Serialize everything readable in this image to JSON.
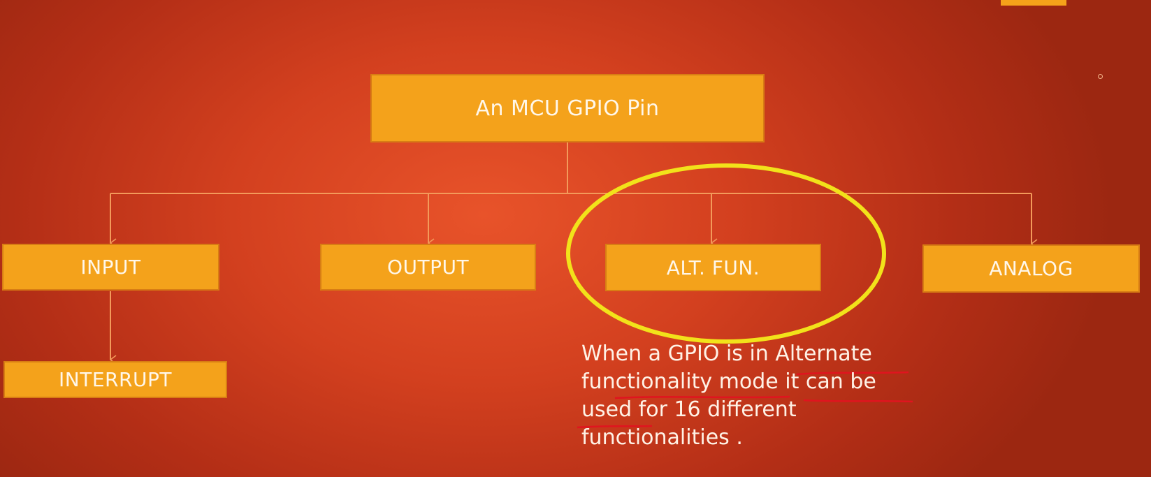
{
  "diagram": {
    "root": {
      "label": "An MCU GPIO Pin"
    },
    "modes": [
      {
        "id": "input",
        "label": "INPUT"
      },
      {
        "id": "output",
        "label": "OUTPUT"
      },
      {
        "id": "alt",
        "label": "ALT. FUN."
      },
      {
        "id": "analog",
        "label": "ANALOG"
      }
    ],
    "sub": {
      "interrupt": {
        "label": "INTERRUPT"
      }
    }
  },
  "note": {
    "lines": [
      "When a GPIO is in Alternate",
      "functionality mode it can be",
      "used for 16 different",
      "functionalities ."
    ]
  },
  "colors": {
    "box_fill": "#f4a21b",
    "connector": "#f39a5a",
    "highlight_ellipse": "#f2e21a",
    "underline": "#e0141f"
  }
}
